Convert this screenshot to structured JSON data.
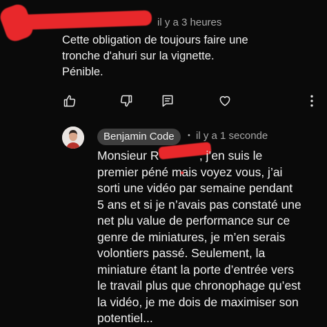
{
  "top_comment": {
    "time": "il y a 3 heures",
    "text_lines": [
      "Cette obligation de toujours faire une",
      "tronche d'ahuri sur la vignette.",
      "Pénible."
    ],
    "actions": [
      {
        "name": "like",
        "icon": "thumbs-up-icon"
      },
      {
        "name": "dislike",
        "icon": "thumbs-down-icon"
      },
      {
        "name": "reply",
        "icon": "reply-icon"
      },
      {
        "name": "heart",
        "icon": "heart-icon"
      },
      {
        "name": "more",
        "icon": "more-options-icon"
      }
    ]
  },
  "reply": {
    "author": "Benjamin Code",
    "separator": "•",
    "time": "il y a 1 seconde",
    "text_lines": [
      "Monsieur R            , j’en suis le",
      "premier péné mais voyez vous, j’ai",
      "sorti une vidéo par semaine pendant",
      "5 ans et si je n’avais pas constaté une",
      "net plu value de performance sur ce",
      "genre de miniatures, je m’en serais",
      "volontiers passé. Seulement, la",
      "miniature étant la porte d’entrée vers",
      "le travail plus que chronophage qu’est",
      "la vidéo, je me dois de maximiser son",
      "potentiel..."
    ]
  },
  "colors": {
    "background": "#0a0a0a",
    "text": "#f1f1f1",
    "meta": "#a8a8a8",
    "badge": "#3f3f3f",
    "redaction": "#e8282b"
  }
}
